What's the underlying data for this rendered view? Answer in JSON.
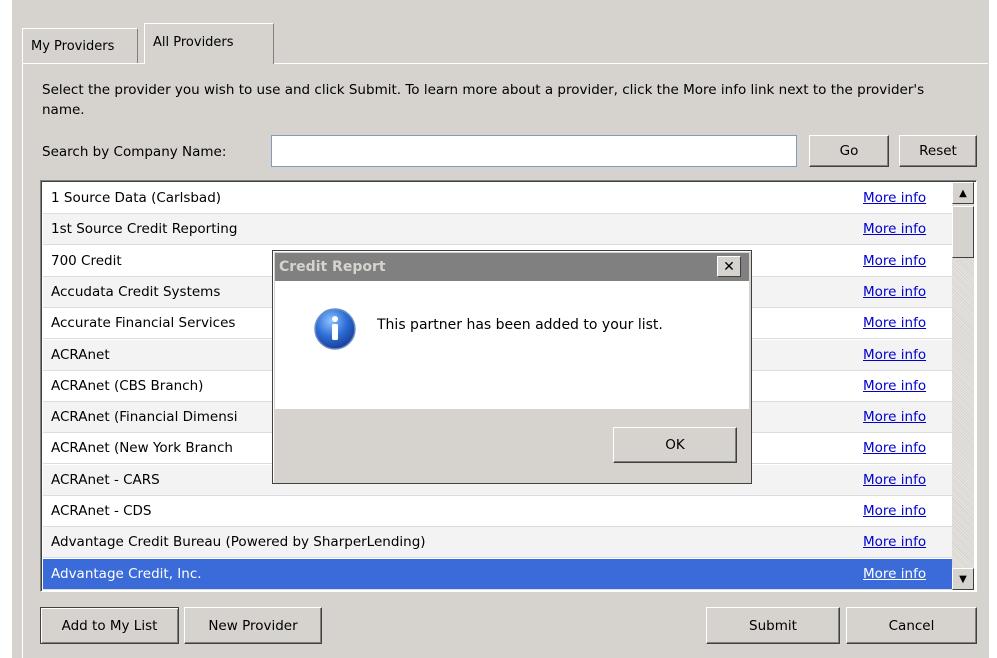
{
  "tabs": [
    {
      "label": "My Providers"
    },
    {
      "label": "All Providers"
    }
  ],
  "instructions": "Select the provider you wish to use and click Submit. To learn more about a provider, click the More info link next to the provider's name.",
  "search": {
    "label": "Search by Company Name:",
    "value": "",
    "go_label": "Go",
    "reset_label": "Reset"
  },
  "providers": [
    {
      "name": "1 Source Data (Carlsbad)",
      "link": "More info"
    },
    {
      "name": "1st Source Credit Reporting",
      "link": "More info"
    },
    {
      "name": "700 Credit",
      "link": "More info"
    },
    {
      "name": "Accudata Credit Systems",
      "link": "More info"
    },
    {
      "name": "Accurate Financial Services",
      "link": "More info"
    },
    {
      "name": "ACRAnet",
      "link": "More info"
    },
    {
      "name": "ACRAnet (CBS Branch)",
      "link": "More info"
    },
    {
      "name": "ACRAnet (Financial Dimensi",
      "link": "More info"
    },
    {
      "name": "ACRAnet (New York Branch",
      "link": "More info"
    },
    {
      "name": "ACRAnet - CARS",
      "link": "More info"
    },
    {
      "name": "ACRAnet - CDS",
      "link": "More info"
    },
    {
      "name": "Advantage Credit Bureau (Powered by SharperLending)",
      "link": "More info"
    },
    {
      "name": "Advantage Credit, Inc.",
      "link": "More info",
      "selected": true
    }
  ],
  "footer": {
    "add_label": "Add to My List",
    "new_label": "New Provider",
    "submit_label": "Submit",
    "cancel_label": "Cancel"
  },
  "dialog": {
    "title": "Credit Report",
    "close_glyph": "✕",
    "message": "This partner has been added to your list.",
    "ok_label": "OK",
    "icon": "info-icon"
  },
  "colors": {
    "selection": "#3a6bd9",
    "link": "#0000cc",
    "panel": "#d6d3ce"
  }
}
